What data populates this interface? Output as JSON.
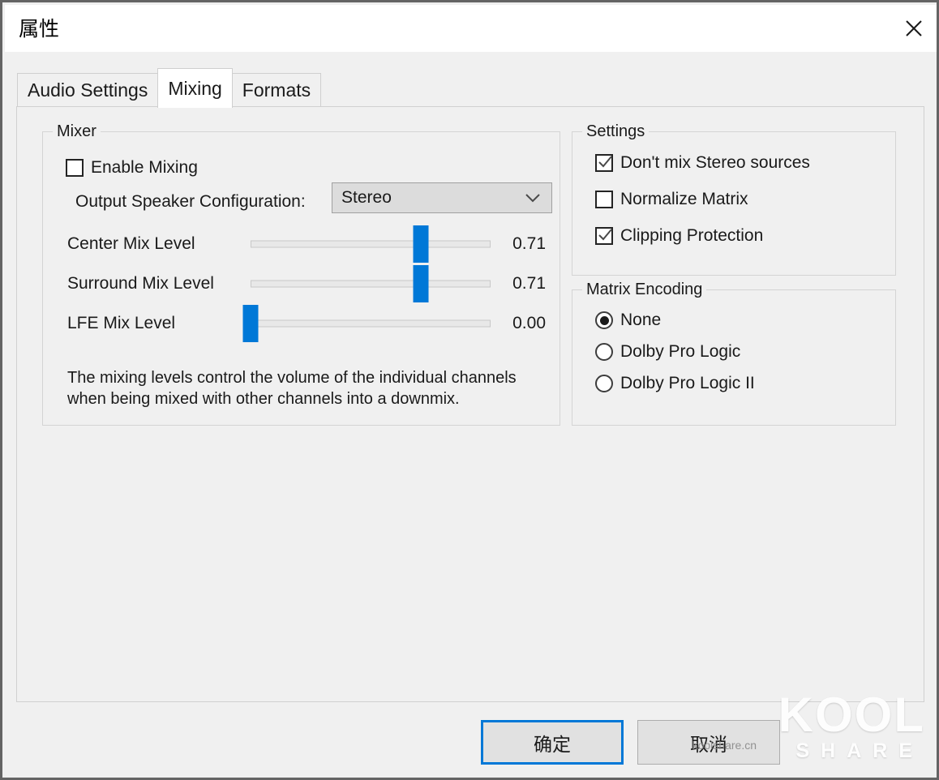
{
  "window": {
    "title": "属性",
    "close_icon": "close-icon"
  },
  "tabs": [
    {
      "label": "Audio Settings",
      "active": false
    },
    {
      "label": "Mixing",
      "active": true
    },
    {
      "label": "Formats",
      "active": false
    }
  ],
  "mixer": {
    "group_title": "Mixer",
    "enable_mixing": {
      "label": "Enable Mixing",
      "checked": false
    },
    "output_speaker": {
      "label": "Output Speaker Configuration:",
      "value": "Stereo",
      "arrow_icon": "chevron-down-icon"
    },
    "sliders": [
      {
        "label": "Center Mix Level",
        "value": "0.71",
        "percent": 71
      },
      {
        "label": "Surround Mix Level",
        "value": "0.71",
        "percent": 71
      },
      {
        "label": "LFE Mix Level",
        "value": "0.00",
        "percent": 0
      }
    ],
    "description": "The mixing levels control the volume of the individual channels when being mixed with other channels into a downmix."
  },
  "settings": {
    "group_title": "Settings",
    "items": [
      {
        "label": "Don't mix Stereo sources",
        "checked": true
      },
      {
        "label": "Normalize Matrix",
        "checked": false
      },
      {
        "label": "Clipping Protection",
        "checked": true
      }
    ]
  },
  "matrix_encoding": {
    "group_title": "Matrix Encoding",
    "options": [
      {
        "label": "None",
        "checked": true
      },
      {
        "label": "Dolby Pro Logic",
        "checked": false
      },
      {
        "label": "Dolby Pro Logic II",
        "checked": false
      }
    ]
  },
  "footer": {
    "ok_label": "确定",
    "cancel_label": "取消"
  },
  "watermark": {
    "brand_top": "KOOL",
    "brand_bottom": "SHARE",
    "site": "koolshare.cn"
  },
  "colors": {
    "accent": "#0078d7",
    "window_bg": "#f0f0f0",
    "titlebar_bg": "#ffffff",
    "border": "#646464"
  }
}
